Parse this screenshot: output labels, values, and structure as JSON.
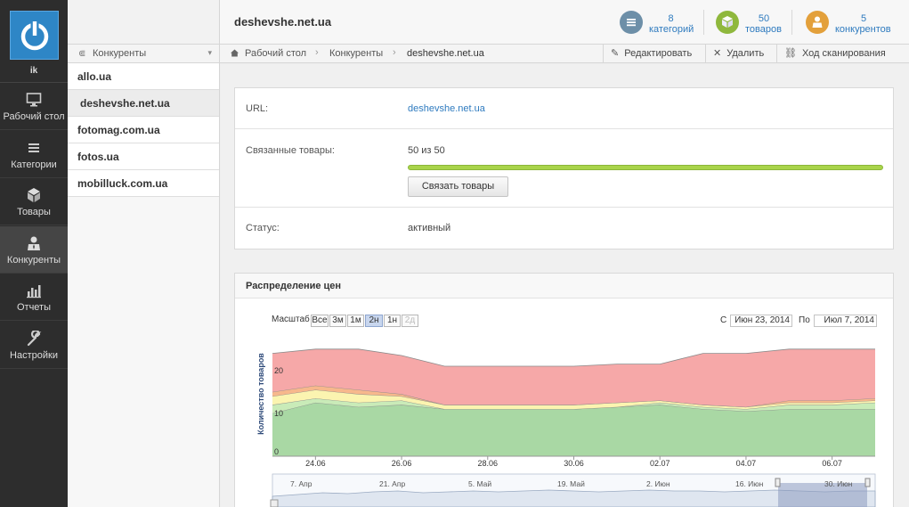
{
  "app": {
    "user_initials": "ik"
  },
  "nav": {
    "items": [
      {
        "label": "Рабочий стол",
        "icon": "monitor-icon"
      },
      {
        "label": "Категории",
        "icon": "list-icon"
      },
      {
        "label": "Товары",
        "icon": "box-icon"
      },
      {
        "label": "Конкуренты",
        "icon": "person-icon"
      },
      {
        "label": "Отчеты",
        "icon": "bar-chart-icon"
      },
      {
        "label": "Настройки",
        "icon": "wrench-icon"
      }
    ]
  },
  "sidebar": {
    "header": "Конкуренты",
    "items": [
      "allo.ua",
      "deshevshe.net.ua",
      "fotomag.com.ua",
      "fotos.ua",
      "mobilluck.com.ua"
    ]
  },
  "header": {
    "title": "deshevshe.net.ua",
    "stats": [
      {
        "number": "8",
        "caption": "категорий",
        "icon": "list-icon",
        "color": "#6d8fa8"
      },
      {
        "number": "50",
        "caption": "товаров",
        "icon": "box-icon",
        "color": "#8fb83d"
      },
      {
        "number": "5",
        "caption": "конкурентов",
        "icon": "person-icon",
        "color": "#e3a03b"
      }
    ]
  },
  "breadcrumb": [
    "Рабочий стол",
    "Конкуренты",
    "deshevshe.net.ua"
  ],
  "actions": {
    "edit": "Редактировать",
    "delete": "Удалить",
    "scan": "Ход сканирования"
  },
  "details": {
    "url_label": "URL:",
    "url_value": "deshevshe.net.ua",
    "linked_label": "Связанные товары:",
    "linked_value": "50 из 50",
    "linked_progress": 1.0,
    "link_button": "Связать товары",
    "status_label": "Статус:",
    "status_value": "активный"
  },
  "chart_panel": {
    "title": "Распределение цен",
    "zoom_label": "Масштаб",
    "zoom_options": [
      "Все",
      "3м",
      "1м",
      "2н",
      "1н",
      "2д"
    ],
    "zoom_selected": "2н",
    "from_label": "С",
    "from_date": "Июн 23, 2014",
    "to_label": "По",
    "to_date": "Июл 7, 2014",
    "navigator_labels": [
      "7. Апр",
      "21. Апр",
      "5. Май",
      "19. Май",
      "2. Июн",
      "16. Июн",
      "30. Июн"
    ]
  },
  "chart_data": {
    "type": "area",
    "ylabel": "Количество товаров",
    "ylim": [
      0,
      26
    ],
    "yticks": [
      0,
      10,
      20
    ],
    "xtick_labels": [
      "24.06",
      "26.06",
      "28.06",
      "30.06",
      "02.07",
      "04.07",
      "06.07"
    ],
    "x": [
      "23.06",
      "24.06",
      "25.06",
      "26.06",
      "27.06",
      "28.06",
      "29.06",
      "30.06",
      "01.07",
      "02.07",
      "03.07",
      "04.07",
      "05.07",
      "06.07",
      "07.07"
    ],
    "series": [
      {
        "color": "#a9d8a4",
        "values": [
          10,
          12.5,
          11.5,
          12,
          11,
          11,
          11,
          11,
          11.5,
          12,
          11,
          10.5,
          11,
          11,
          11
        ]
      },
      {
        "color": "#c9ebb8",
        "values": [
          2,
          1,
          1,
          1,
          0,
          0,
          0,
          0,
          0,
          0.5,
          0.5,
          0.5,
          1,
          1,
          1.5
        ]
      },
      {
        "color": "#fbf4b0",
        "values": [
          2,
          2,
          2,
          1,
          1,
          1,
          1,
          1,
          1,
          0.5,
          0.5,
          0.5,
          0.5,
          0.5,
          0.5
        ]
      },
      {
        "color": "#f7b88c",
        "values": [
          1,
          1,
          1,
          0.5,
          0,
          0,
          0,
          0,
          0,
          0,
          0,
          0,
          0.5,
          0.5,
          0.5
        ]
      },
      {
        "color": "#f6a8a8",
        "values": [
          9,
          8.5,
          9.5,
          9,
          9,
          9,
          9,
          9,
          9,
          8.5,
          12,
          12.5,
          12,
          12,
          11.5
        ]
      }
    ]
  }
}
